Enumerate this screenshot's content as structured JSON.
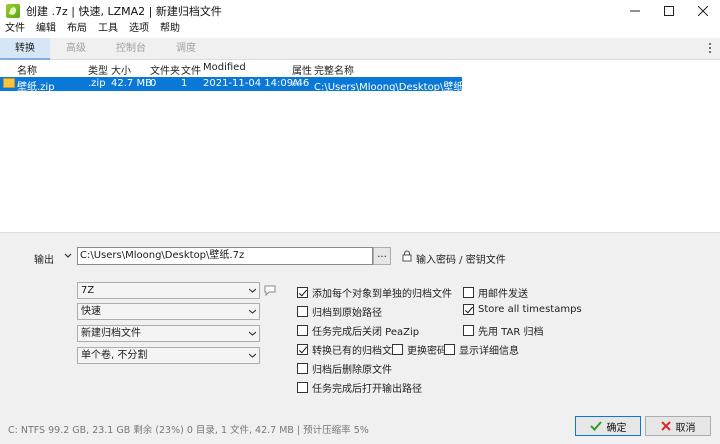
{
  "window": {
    "title": "创建 .7z | 快速, LZMA2 | 新建归档文件",
    "minimize_icon": "minimize-icon",
    "maximize_icon": "maximize-icon",
    "close_icon": "close-icon"
  },
  "menu": {
    "items": [
      "文件",
      "编辑",
      "布局",
      "工具",
      "选项",
      "帮助"
    ]
  },
  "tabs": {
    "items": [
      {
        "label": "转换",
        "active": true
      },
      {
        "label": "高级",
        "active": false
      },
      {
        "label": "控制台",
        "active": false
      },
      {
        "label": "调度",
        "active": false
      }
    ]
  },
  "filelist": {
    "columns": [
      "名称",
      "类型",
      "大小",
      "文件夹",
      "文件",
      "Modified",
      "属性",
      "完整名称"
    ],
    "rows": [
      {
        "name": "壁纸.zip",
        "type": ".zip",
        "size": "42.7 MB",
        "folders": "0",
        "files": "1",
        "modified": "2021-11-04 14:09:46",
        "attributes": "A",
        "full_name": "C:\\Users\\Mloong\\Desktop\\壁纸.zip",
        "selected": true
      }
    ]
  },
  "output": {
    "label": "输出",
    "path": "C:\\Users\\Mloong\\Desktop\\壁纸.7z",
    "browse_label": "...",
    "password_label": "输入密码 / 密钥文件"
  },
  "options": {
    "format": "7Z",
    "speed": "快速",
    "archive_mode": "新建归档文件",
    "split": "单个卷, 不分割"
  },
  "checkboxes": {
    "add_each_separately": {
      "label": "添加每个对象到单独的归档文件",
      "checked": true
    },
    "archive_to_original_path": {
      "label": "归档到原始路径",
      "checked": false
    },
    "close_when_done": {
      "label": "任务完成后关闭 PeaZip",
      "checked": false
    },
    "convert_existing": {
      "label": "转换已有的归档文件",
      "checked": true
    },
    "delete_after_archive": {
      "label": "归档后删除原文件",
      "checked": false
    },
    "open_output_path": {
      "label": "任务完成后打开输出路径",
      "checked": false
    },
    "send_by_mail": {
      "label": "用邮件发送",
      "checked": false
    },
    "store_timestamps": {
      "label": "Store all timestamps",
      "checked": true
    },
    "tar_first": {
      "label": "先用 TAR 归档",
      "checked": false
    },
    "change_password": {
      "label": "更换密码",
      "checked": false
    },
    "show_details": {
      "label": "显示详细信息",
      "checked": false
    }
  },
  "status": {
    "text": "C: NTFS 99.2 GB, 23.1 GB 剩余 (23%)    0 目录,  1 文件,  42.7 MB | 预计压缩率 5%"
  },
  "buttons": {
    "ok_label": "确定",
    "cancel_label": "取消"
  },
  "colors": {
    "selection": "#0a78d7",
    "ok_check": "#2e9e2e",
    "cancel_x": "#d22f2f",
    "active_tab": "#d7e6f6"
  }
}
